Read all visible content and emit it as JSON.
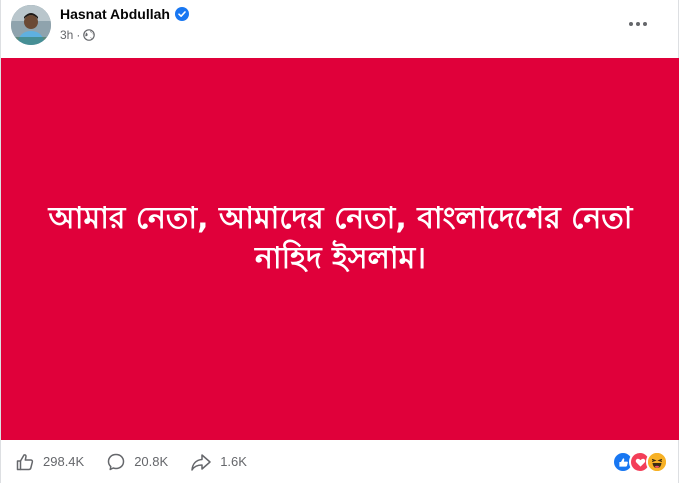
{
  "post": {
    "author": "Hasnat Abdullah",
    "time": "3h",
    "separator": "·",
    "banner_text": "আমার নেতা, আমাদের নেতা, বাংলাদেশের নেতা নাহিদ ইসলাম।",
    "banner_color": "#e0003a"
  },
  "actions": {
    "like_count": "298.4K",
    "comment_count": "20.8K",
    "share_count": "1.6K"
  },
  "reactions": [
    "like",
    "love",
    "haha"
  ],
  "icons": {
    "verified": "verified-badge-icon",
    "privacy": "globe-icon",
    "more": "more-options-icon"
  }
}
